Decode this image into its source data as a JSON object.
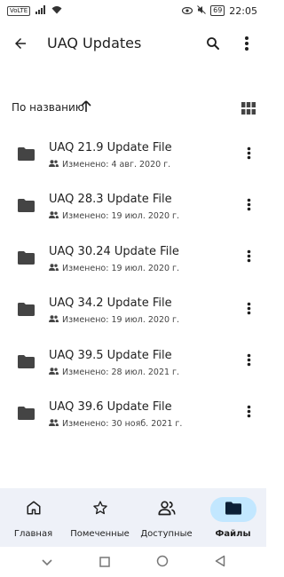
{
  "status_bar": {
    "volte": "VoLTE",
    "battery": "69",
    "time": "22:05"
  },
  "app_bar": {
    "title": "UAQ Updates"
  },
  "sort": {
    "label": "По названию"
  },
  "files": [
    {
      "name": "UAQ 21.9 Update File",
      "modified": "Изменено: 4 авг. 2020 г."
    },
    {
      "name": "UAQ 28.3 Update File",
      "modified": "Изменено: 19 июл. 2020 г."
    },
    {
      "name": "UAQ 30.24 Update File",
      "modified": "Изменено: 19 июл. 2020 г."
    },
    {
      "name": "UAQ 34.2 Update File",
      "modified": "Изменено: 19 июл. 2020 г."
    },
    {
      "name": "UAQ 39.5 Update File",
      "modified": "Изменено: 28 июл. 2021 г."
    },
    {
      "name": "UAQ 39.6 Update File",
      "modified": "Изменено: 30 нояб. 2021 г."
    }
  ],
  "bottom_nav": {
    "home": "Главная",
    "starred": "Помеченные",
    "shared": "Доступные",
    "files": "Файлы"
  },
  "colors": {
    "accent": "#c2e7ff",
    "nav_background": "#eef1f8",
    "text": "#1f1f1f"
  }
}
